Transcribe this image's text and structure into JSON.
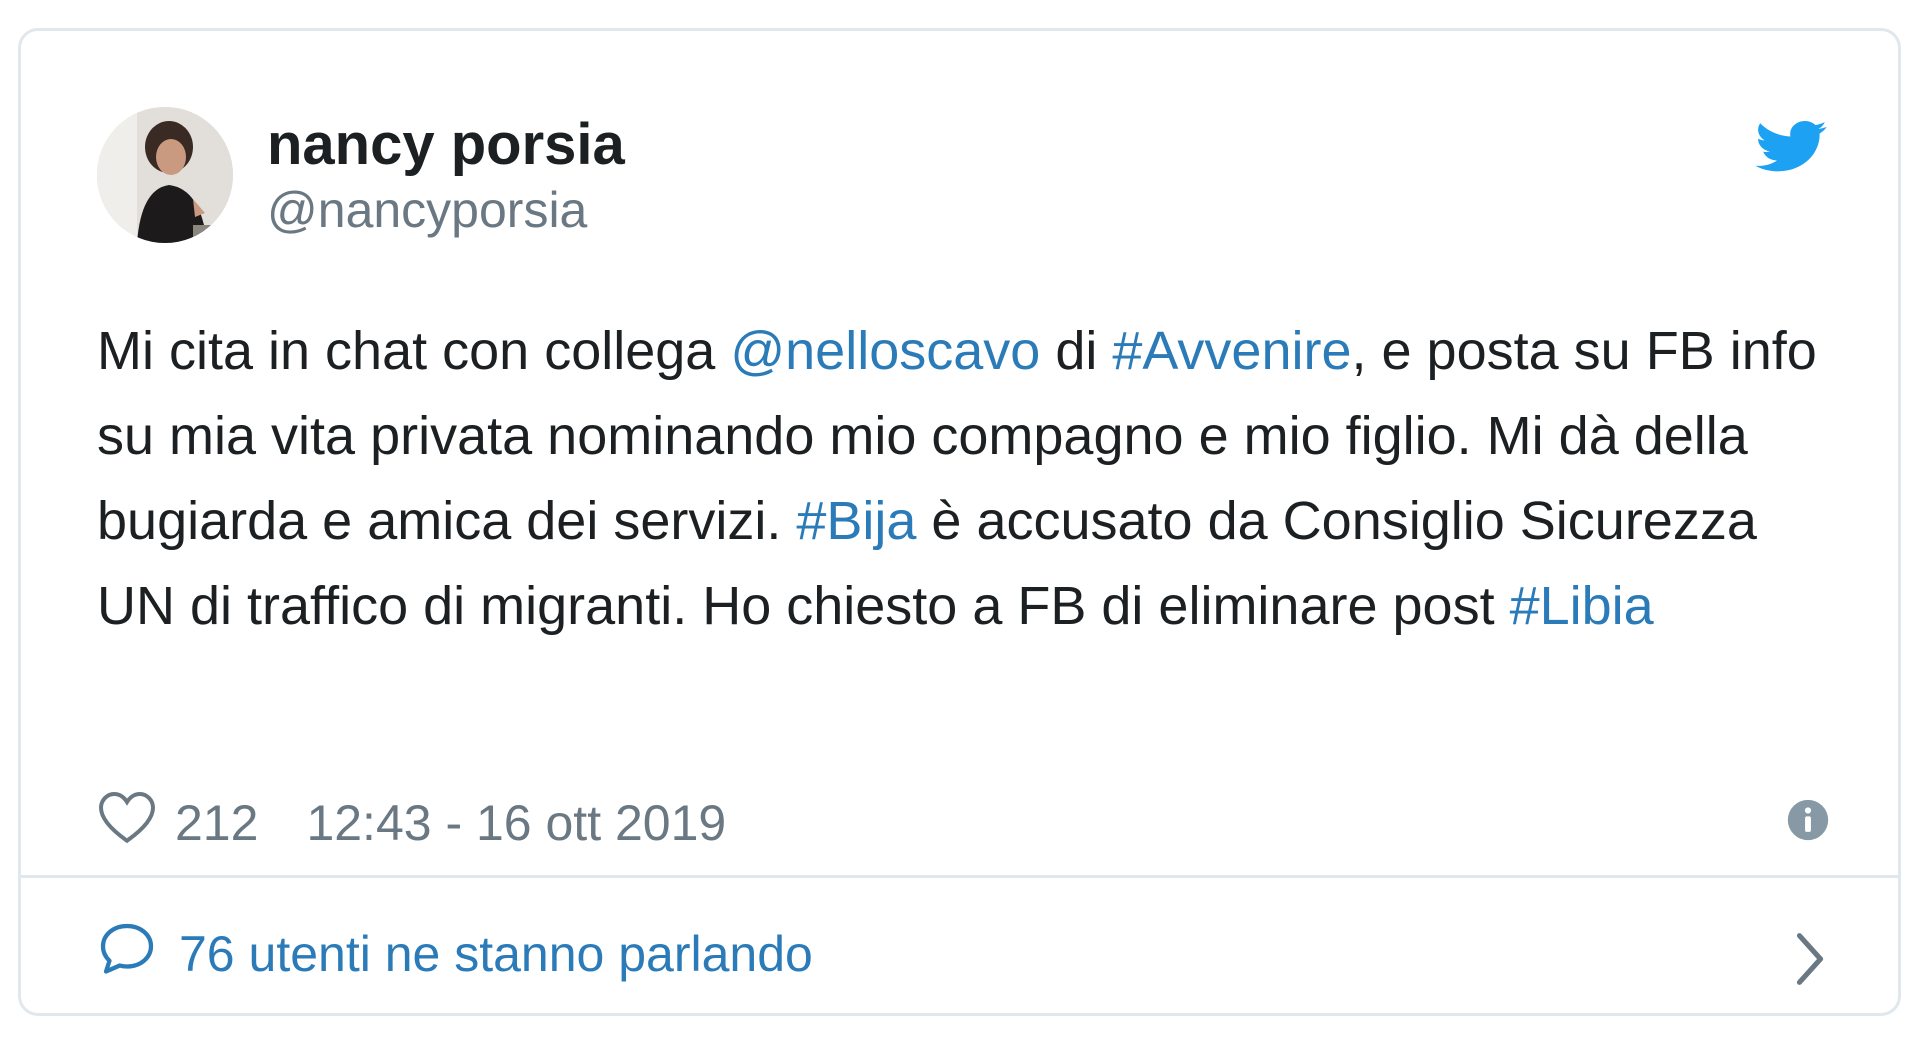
{
  "tweet": {
    "display_name": "nancy porsia",
    "handle": "@nancyporsia",
    "text": [
      {
        "t": "Mi cita in chat con collega ",
        "link": false
      },
      {
        "t": "@nelloscavo",
        "link": true
      },
      {
        "t": " di ",
        "link": false
      },
      {
        "t": "#Avvenire",
        "link": true
      },
      {
        "t": ", e posta su FB info su mia vita privata nominando mio compagno e mio figlio. Mi dà della bugiarda e amica dei servizi. ",
        "link": false
      },
      {
        "t": "#Bija",
        "link": true
      },
      {
        "t": " è accusato da Consiglio Sicurezza UN di traffico di migranti. Ho chiesto a FB di eliminare post ",
        "link": false
      },
      {
        "t": "#Libia",
        "link": true
      }
    ],
    "likes": "212",
    "timestamp": "12:43 - 16 ott 2019",
    "conversation_label": "76 utenti ne stanno parlando"
  },
  "icons": {
    "brand": "twitter-bird-icon",
    "like": "heart-icon",
    "info": "info-icon",
    "reply": "speech-bubble-icon",
    "more": "chevron-right-icon"
  },
  "colors": {
    "link": "#2b7bb9",
    "brand": "#1da1f2",
    "text": "#1c2022",
    "muted": "#697882",
    "border": "#e1e8ed"
  }
}
